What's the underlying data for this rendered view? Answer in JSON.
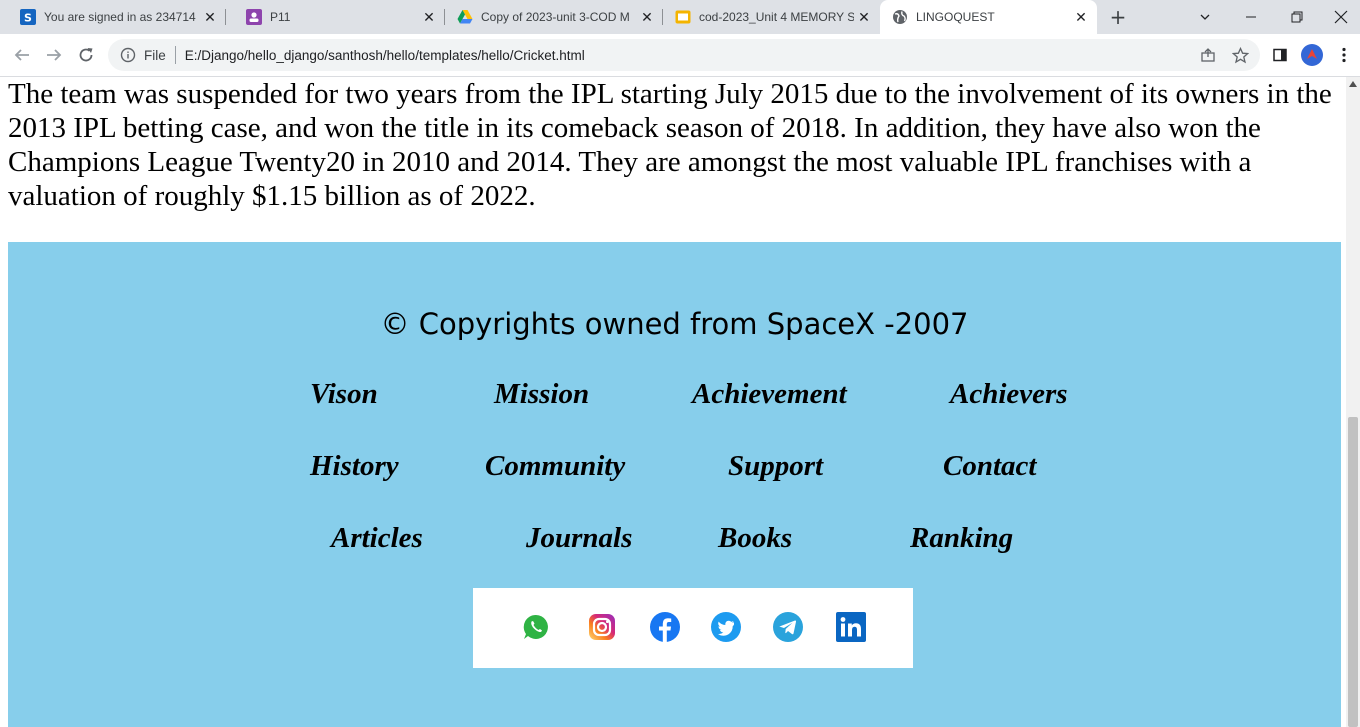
{
  "browser": {
    "tabs": [
      {
        "title": "You are signed in as 234714",
        "icon": "s-brand-icon",
        "active": false
      },
      {
        "title": "P11",
        "icon": "contact-card-icon",
        "active": false
      },
      {
        "title": "Copy of 2023-unit 3-COD M",
        "icon": "google-drive-icon",
        "active": false
      },
      {
        "title": "cod-2023_Unit 4 MEMORY S",
        "icon": "google-slides-icon",
        "active": false
      },
      {
        "title": "LINGOQUEST",
        "icon": "globe-icon",
        "active": true
      }
    ],
    "new_tab_label": "+",
    "address": {
      "scheme_label": "File",
      "url": "E:/Django/hello_django/santhosh/hello/templates/hello/Cricket.html"
    }
  },
  "page": {
    "paragraph": "The team was suspended for two years from the IPL starting July 2015 due to the involvement of its owners in the 2013 IPL betting case, and won the title in its comeback season of 2018. In addition, they have also won the Champions League Twenty20 in 2010 and 2014. They are amongst the most valuable IPL franchises with a valuation of roughly $1.15 billion as of 2022.",
    "footer": {
      "copyright": "© Copyrights owned from SpaceX -2007",
      "links_row1": [
        "Vison",
        "Mission",
        "Achievement",
        "Achievers"
      ],
      "links_row2": [
        "History",
        "Community",
        "Support",
        "Contact"
      ],
      "links_row3": [
        "Articles",
        "Journals",
        "Books",
        "Ranking"
      ],
      "social_icons": [
        "whatsapp-icon",
        "instagram-icon",
        "facebook-icon",
        "twitter-icon",
        "telegram-icon",
        "linkedin-icon"
      ]
    }
  },
  "colors": {
    "footer_bg": "#87ceeb",
    "tabstrip_bg": "#dee1e6",
    "omnibox_bg": "#f1f3f4"
  }
}
